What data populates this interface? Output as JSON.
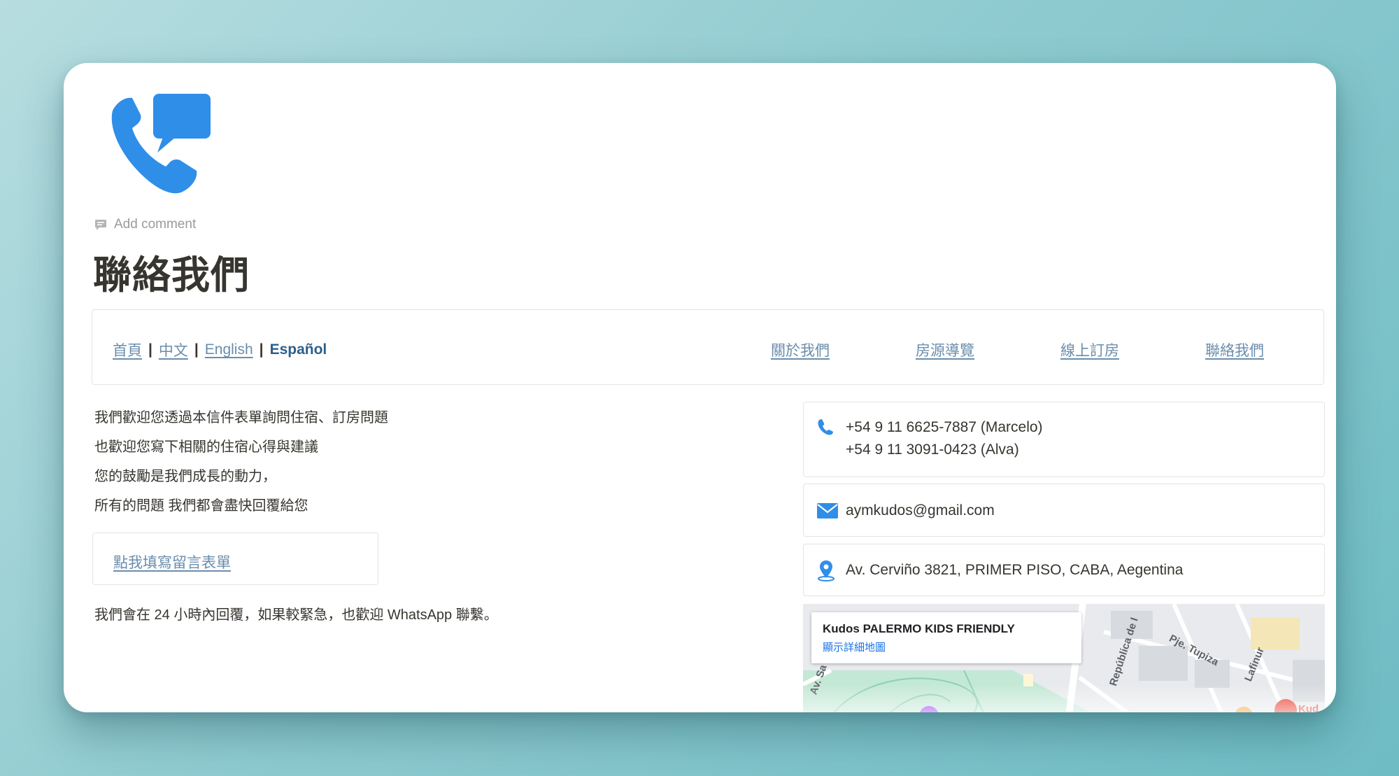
{
  "page": {
    "icon": "phone-chat-icon",
    "add_comment": "Add comment",
    "title": "聯絡我們"
  },
  "nav": {
    "languages": [
      {
        "label": "首頁"
      },
      {
        "label": "中文"
      },
      {
        "label": "English"
      },
      {
        "label": "Español"
      }
    ],
    "separator": "|",
    "links": [
      {
        "label": "關於我們"
      },
      {
        "label": "房源導覽"
      },
      {
        "label": "線上訂房"
      },
      {
        "label": "聯絡我們"
      }
    ]
  },
  "intro": {
    "lines": [
      "我們歡迎您透過本信件表單詢問住宿、訂房問題",
      "也歡迎您寫下相關的住宿心得與建議",
      "您的鼓勵是我們成長的動力，",
      "所有的問題 我們都會盡快回覆給您"
    ],
    "form_button": "點我填寫留言表單",
    "reply_note": "我們會在 24 小時內回覆，如果較緊急，也歡迎 WhatsApp 聯繫。"
  },
  "contact": {
    "phone_icon": "phone-icon",
    "phones": [
      "+54 9 11 6625-7887 (Marcelo)",
      "+54 9 11 3091-0423 (Alva)"
    ],
    "email_icon": "mail-icon",
    "email": "aymkudos@gmail.com",
    "address_icon": "location-pin-icon",
    "address": "Av. Cerviño 3821, PRIMER PISO, CABA, Aegentina"
  },
  "map": {
    "place_name": "Kudos PALERMO KIDS FRIENDLY",
    "detail_link": "顯示詳細地圖",
    "streets": [
      "República de I",
      "Pje. Tupiza",
      "Lafinur",
      "Av. Sa",
      "Kud"
    ]
  },
  "colors": {
    "accent_blue": "#2f8ee8",
    "link_blue": "#6a8dac",
    "text": "#37352f",
    "muted": "#9b9a97",
    "background_teal": "#8fcbd0"
  }
}
